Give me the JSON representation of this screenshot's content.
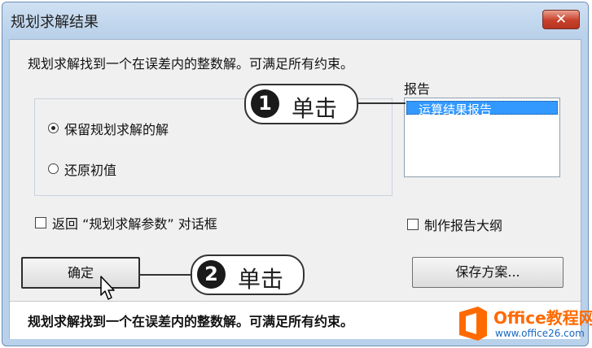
{
  "window": {
    "title": "规划求解结果",
    "close_glyph": "✕"
  },
  "main": {
    "message": "规划求解找到一个在误差内的整数解。可满足所有约束。",
    "options": [
      {
        "label": "保留规划求解的解",
        "selected": true
      },
      {
        "label": "还原初值",
        "selected": false
      }
    ],
    "return_checkbox_label": "返回 “规划求解参数” 对话框",
    "outline_checkbox_label": "制作报告大纲"
  },
  "report": {
    "label": "报告",
    "items": [
      {
        "label": "运算结果报告",
        "selected": true
      }
    ]
  },
  "buttons": {
    "ok_label": "确定",
    "save_scenario_label": "保存方案..."
  },
  "status": {
    "text": "规划求解找到一个在误差内的整数解。可满足所有约束。"
  },
  "annotations": [
    {
      "number": "1",
      "text": "单击"
    },
    {
      "number": "2",
      "text": "单击"
    }
  ],
  "watermark": {
    "brand": "Office教程网",
    "url": "www.office26.com"
  }
}
